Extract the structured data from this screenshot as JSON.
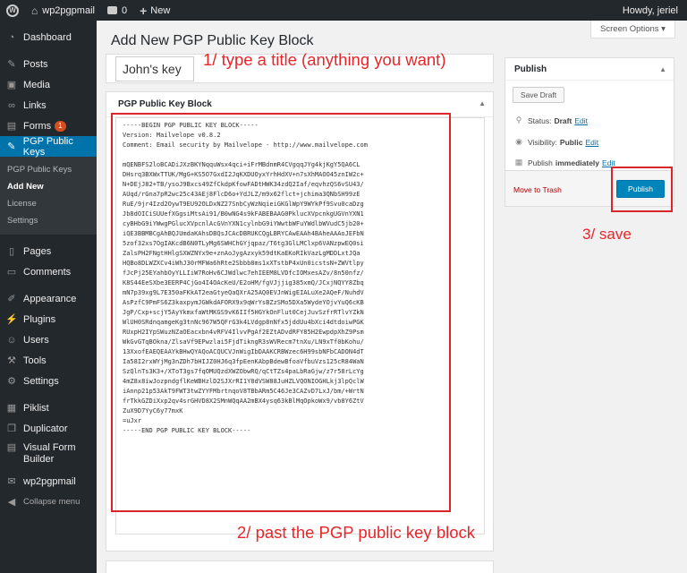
{
  "adminbar": {
    "site_name": "wp2pgpmail",
    "comments_count": "0",
    "new_label": "New",
    "greeting": "Howdy, jeriel"
  },
  "sidebar": {
    "items": [
      {
        "label": "Dashboard",
        "icon": "dashboard-icon"
      },
      {
        "label": "Posts",
        "icon": "pushpin-icon"
      },
      {
        "label": "Media",
        "icon": "media-icon"
      },
      {
        "label": "Links",
        "icon": "link-icon"
      },
      {
        "label": "Forms",
        "icon": "forms-icon",
        "badge": "1"
      },
      {
        "label": "PGP Public Keys",
        "icon": "pushpin-icon",
        "current": true
      },
      {
        "label": "Pages",
        "icon": "pages-icon"
      },
      {
        "label": "Comments",
        "icon": "comments-icon"
      },
      {
        "label": "Appearance",
        "icon": "brush-icon"
      },
      {
        "label": "Plugins",
        "icon": "plugin-icon"
      },
      {
        "label": "Users",
        "icon": "users-icon"
      },
      {
        "label": "Tools",
        "icon": "wrench-icon"
      },
      {
        "label": "Settings",
        "icon": "settings-icon"
      },
      {
        "label": "Piklist",
        "icon": "piklist-icon"
      },
      {
        "label": "Duplicator",
        "icon": "duplicator-icon"
      },
      {
        "label": "Visual Form Builder",
        "icon": "form-builder-icon"
      },
      {
        "label": "wp2pgpmail",
        "icon": "mail-icon"
      },
      {
        "label": "Collapse menu",
        "icon": "collapse-icon"
      }
    ],
    "submenu": [
      "PGP Public Keys",
      "Add New",
      "License",
      "Settings"
    ]
  },
  "main": {
    "screen_options": "Screen Options ▾",
    "page_title": "Add New PGP Public Key Block",
    "title_value": "John's key",
    "pgp_box_title": "PGP Public Key Block",
    "pgp_lines": [
      "-----BEGIN PGP PUBLIC KEY BLOCK-----",
      "Version: Mailvelope v0.8.2",
      "Comment: Email security by Mailvelope - http://www.mailvelope.com",
      "",
      "mQENBFS2loBCADiJXzBKYNqquWsx4qci+iFrMBdnmR4CVgqqJYg4kjKgY5QA6CL",
      "DHsrq3BXWxTTUK/MgG+KS5O7GxdI2JqKXDUOyxYrhHdXV+n7sXhMAOO45znIW2c+",
      "N+DEjJ82+TB/ysoJ9Bxcs49ZfCkdpKfowFADtHWK34zdQ2Iaf/eqvhzQS6vSU43/",
      "AUqd/rGna7pR2wc25c43AEj8FlcD6o+YdJLZ/m9x62flct+jchima3QNbSH99zE",
      "RuE/9jr4Izd2OywT9EU92OLDxNZ27SnbCyWzNqieiGKGlWpY9WYkPf9Svu0caDzg",
      "Jb8dOICiSUUefXGgsiMtsAi91/B0wNG4s9kFABEBAAG0PklucXVpcnkgUGVnYXN1",
      "cyBHbG9iYWwgPGlucXVpcnlAcGVnYXN1cylnbG9iYWwtbWFuYWdlbWVudC5jb20+",
      "iQE3BBMBCgAhBQJUmdaKAhsDBQsJCAcDBRUKCQgLBRYCAwEAAh4BAheAAAoJEFbN",
      "5zof32xs7OgIAKcdB6N0TLyMg6SWHChGYjqpaz/T6tg3GlLMClxp6VANzpwEQ0si",
      "ZalsPH2FNgtHHlgSXWZNYx9e+znAoJygAzxyk59dtKaEKoRIkVazLgMDDLxtJQa",
      "HQBo8DLWZXCv4iWhJ30rMFWa6hRte2Sbbb8ms1xXTstbP4xUn0icstsN+ZWVtlpy",
      "fJcPj25EYahbOyYLLIiW7RoHv6CJWdlwc7ehIEEM8LVDfcIOMxesAZv/8n50nfz/",
      "K8S44EeSXbe3EERP4CjGo4I4OAcKeU/E2oHM/fgVJjjig385xmQ/JCxjNQYY8Zbq",
      "mN7p39xg9L7E350aFKkAT2eaGtyeQaQXrA25AQ0EVJnWigEIALuXe2AQeF/NuhdV",
      "AsPzfC9PmFS6Z3kaxpymJGWkdAFORX9x9qWrYsBZzSMo5DXa5WydeYOjvYuQ6cKB",
      "JgP/Cxp+scjY5AyYkmxfaWtMKGS9vK6IIf5HGYkOnFlut0CejJuvSzfrRTlvYZkN",
      "WlUH0SRdnqamgeKg3tnNc967W5QFrG3k4LVdgp8nNfx5jddUu4bXci4dtdoiwPGK",
      "RUxpH2IYpSWuzNZaOEacxbn4vRFV4IlvvPgAf2EZtADvdRFY85H2EwpdpXhZ9Psm",
      "WkGvGTqBOkna/ZlsaVf9EPwzlai5FjdTikngR3sWVRecm7tnXu/LN9xTf0bKohu/",
      "13XxofEAEQEAAYkBHwQYAQoACQUCVJnWigIbDAAKCRBWzec6H99sbNFbCADON4dT",
      "Ia58I2rxWYjMg3nZDh7bHIJZ0HJ6q3fpEenKAbpBdewBfoaVfbuVzs125cR84WaN",
      "SzQlnTs3K3+/XToT3gs7fqOMUQzdXWZObwRQ/qCtTZs4paLbRaGjw/z7r58rLcYg",
      "4mZ8x8iwJozpndgflKeWBHzlD2SJXrRI1Y8dVSW88JuHZLVQONIOGHLkj3lpQclW",
      "iAnnp21p53AkT9FWT3twZYYFMbrtnqoV8TBbARm5C46Je3CAZvD7LxJ/bm/+WrtN",
      "frTkkGZDiXxp2qv4srGHVD8X2SMnWQqAA2mBX4ysq63kBlMqOpkoWx9/vb8Y6ZtV",
      "ZuX9D7YyC6y77mxK",
      "=uJxr",
      "-----END PGP PUBLIC KEY BLOCK-----"
    ]
  },
  "annotations": {
    "step1": "1/ type a title (anything you want)",
    "step2": "2/ past the PGP public key block",
    "step3": "3/ save"
  },
  "publish": {
    "title": "Publish",
    "save_draft": "Save Draft",
    "status_label": "Status:",
    "status_value": "Draft",
    "visibility_label": "Visibility:",
    "visibility_value": "Public",
    "publish_label": "Publish",
    "publish_value": "immediately",
    "edit_label": "Edit",
    "trash_label": "Move to Trash",
    "publish_button": "Publish"
  }
}
